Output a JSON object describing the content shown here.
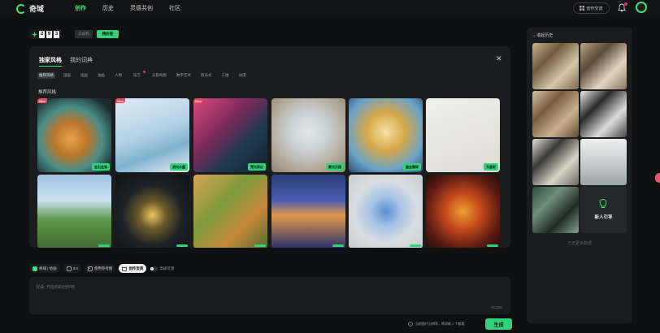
{
  "app": {
    "name": "奇域"
  },
  "nav": {
    "items": [
      "创作",
      "历史",
      "灵感共创",
      "社区"
    ],
    "active_index": 0
  },
  "header": {
    "credits_label": "创作交流"
  },
  "counter": {
    "digits": [
      "2",
      "9",
      "3"
    ],
    "btn_gray": "三段构",
    "btn_green": "精彩版"
  },
  "panel": {
    "tabs": [
      "独家风格",
      "我的词典"
    ],
    "categories": [
      "推荐风格",
      "国画",
      "插画",
      "油画",
      "人物",
      "技艺",
      "光影构图",
      "数字艺术",
      "取法式",
      "三维",
      "动漫"
    ],
    "section_title": "推荐风格",
    "cards": [
      {
        "tag": "金石金箔",
        "badge": "New",
        "theme": "tiger"
      },
      {
        "tag": "流光水墨",
        "badge": "New",
        "theme": "tree"
      },
      {
        "tag": "霓光奇幻",
        "badge": "New",
        "theme": "neon"
      },
      {
        "tag": "雾光乐园",
        "badge": "",
        "theme": "arch"
      },
      {
        "tag": "鎏金雕琢",
        "badge": "",
        "theme": "horse"
      },
      {
        "tag": "东瓷彩",
        "badge": "",
        "theme": "bird"
      },
      {
        "tag": "",
        "badge": "",
        "theme": "landscape"
      },
      {
        "tag": "",
        "badge": "",
        "theme": "night"
      },
      {
        "tag": "",
        "badge": "",
        "theme": "mosaic"
      },
      {
        "tag": "",
        "badge": "",
        "theme": "boat"
      },
      {
        "tag": "",
        "badge": "",
        "theme": "flower"
      },
      {
        "tag": "",
        "badge": "",
        "theme": "dragon"
      }
    ]
  },
  "input_bar": {
    "model_chip": "奇域 | 绘画",
    "ratio_chip": "3:4",
    "reference_chip": "使用参考图",
    "style_chip": "创作宝典",
    "toggle_label": "高级可调"
  },
  "prompt": {
    "placeholder": "咒语: 开始你的创作吧",
    "count": "0/1000"
  },
  "hint": "当前图片分辨率，将消耗 1 个额度",
  "generate_button": "生成",
  "history": {
    "title": "收起历史",
    "ai_button": "新人引导",
    "empty_text": "已无更多数据"
  },
  "colors": {
    "accent": "#34d17a",
    "badge": "#e84a5f",
    "panel": "#1b1c1e"
  }
}
